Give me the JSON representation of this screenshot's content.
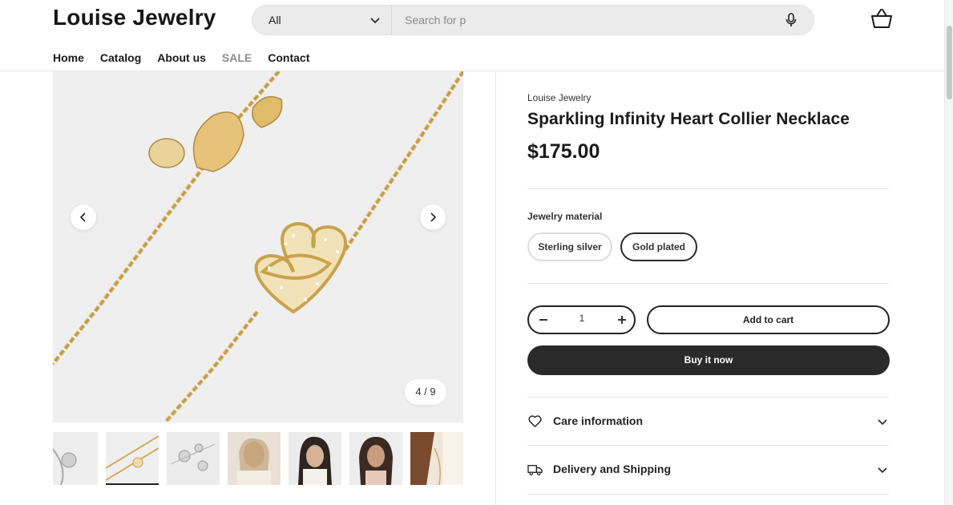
{
  "store": {
    "name": "Louise Jewelry"
  },
  "search": {
    "category": "All",
    "placeholder": "Search for p"
  },
  "nav": {
    "items": [
      "Home",
      "Catalog",
      "About us",
      "SALE",
      "Contact"
    ]
  },
  "gallery": {
    "counter": "4 / 9",
    "current": 4,
    "total": 9
  },
  "product": {
    "vendor": "Louise Jewelry",
    "title": "Sparkling Infinity Heart Collier Necklace",
    "price": "$175.00",
    "option_label": "Jewelry material",
    "options": [
      "Sterling silver",
      "Gold plated"
    ],
    "selected_option": "Gold plated",
    "quantity": "1",
    "add_to_cart": "Add to cart",
    "buy_now": "Buy it now"
  },
  "accordions": [
    "Care information",
    "Delivery and Shipping"
  ],
  "icons": [
    "chevron-down-icon",
    "microphone-icon",
    "basket-icon",
    "chevron-left-icon",
    "chevron-right-icon",
    "minus-icon",
    "plus-icon",
    "heart-icon",
    "truck-icon"
  ],
  "colors": {
    "text": "#1f1f1f",
    "sale": "#8c8c8c",
    "buy_button": "#2a2a2a",
    "gold": "#d9b56a"
  }
}
